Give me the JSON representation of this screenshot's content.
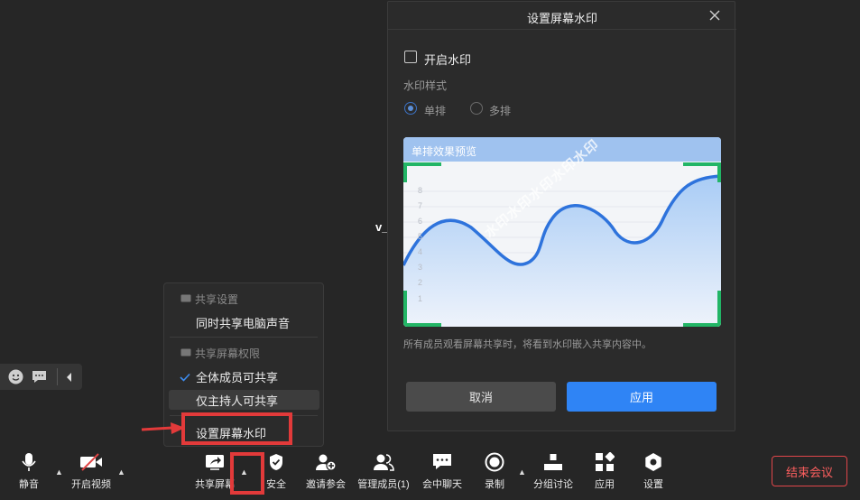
{
  "main": {
    "participant_initial": "v_"
  },
  "share_menu": {
    "section1": "共享设置",
    "item_computer_audio": "同时共享电脑声音",
    "section2": "共享屏幕权限",
    "item_all_members": "全体成员可共享",
    "item_host_only": "仅主持人可共享",
    "item_set_watermark": "设置屏幕水印"
  },
  "dialog": {
    "title": "设置屏幕水印",
    "enable_watermark": "开启水印",
    "style_label": "水印样式",
    "style_single": "单排",
    "style_multi": "多排",
    "preview_title": "单排效果预览",
    "preview_watermark": "水印水印水印水印水印",
    "preview_axis": [
      "8",
      "7",
      "6",
      "5",
      "4",
      "3",
      "2",
      "1"
    ],
    "description": "所有成员观看屏幕共享时，将看到水印嵌入共享内容中。",
    "cancel": "取消",
    "apply": "应用"
  },
  "toolbar": {
    "mute": "静音",
    "video": "开启视频",
    "share": "共享屏幕",
    "security": "安全",
    "invite": "邀请参会",
    "members": "管理成员(1)",
    "chat": "会中聊天",
    "record": "录制",
    "breakout": "分组讨论",
    "apps": "应用",
    "settings": "设置",
    "end": "结束会议"
  },
  "colors": {
    "accent": "#2f84f5",
    "danger": "#e0464a",
    "green_corner": "#22b566",
    "annotation": "#e23a3a"
  }
}
